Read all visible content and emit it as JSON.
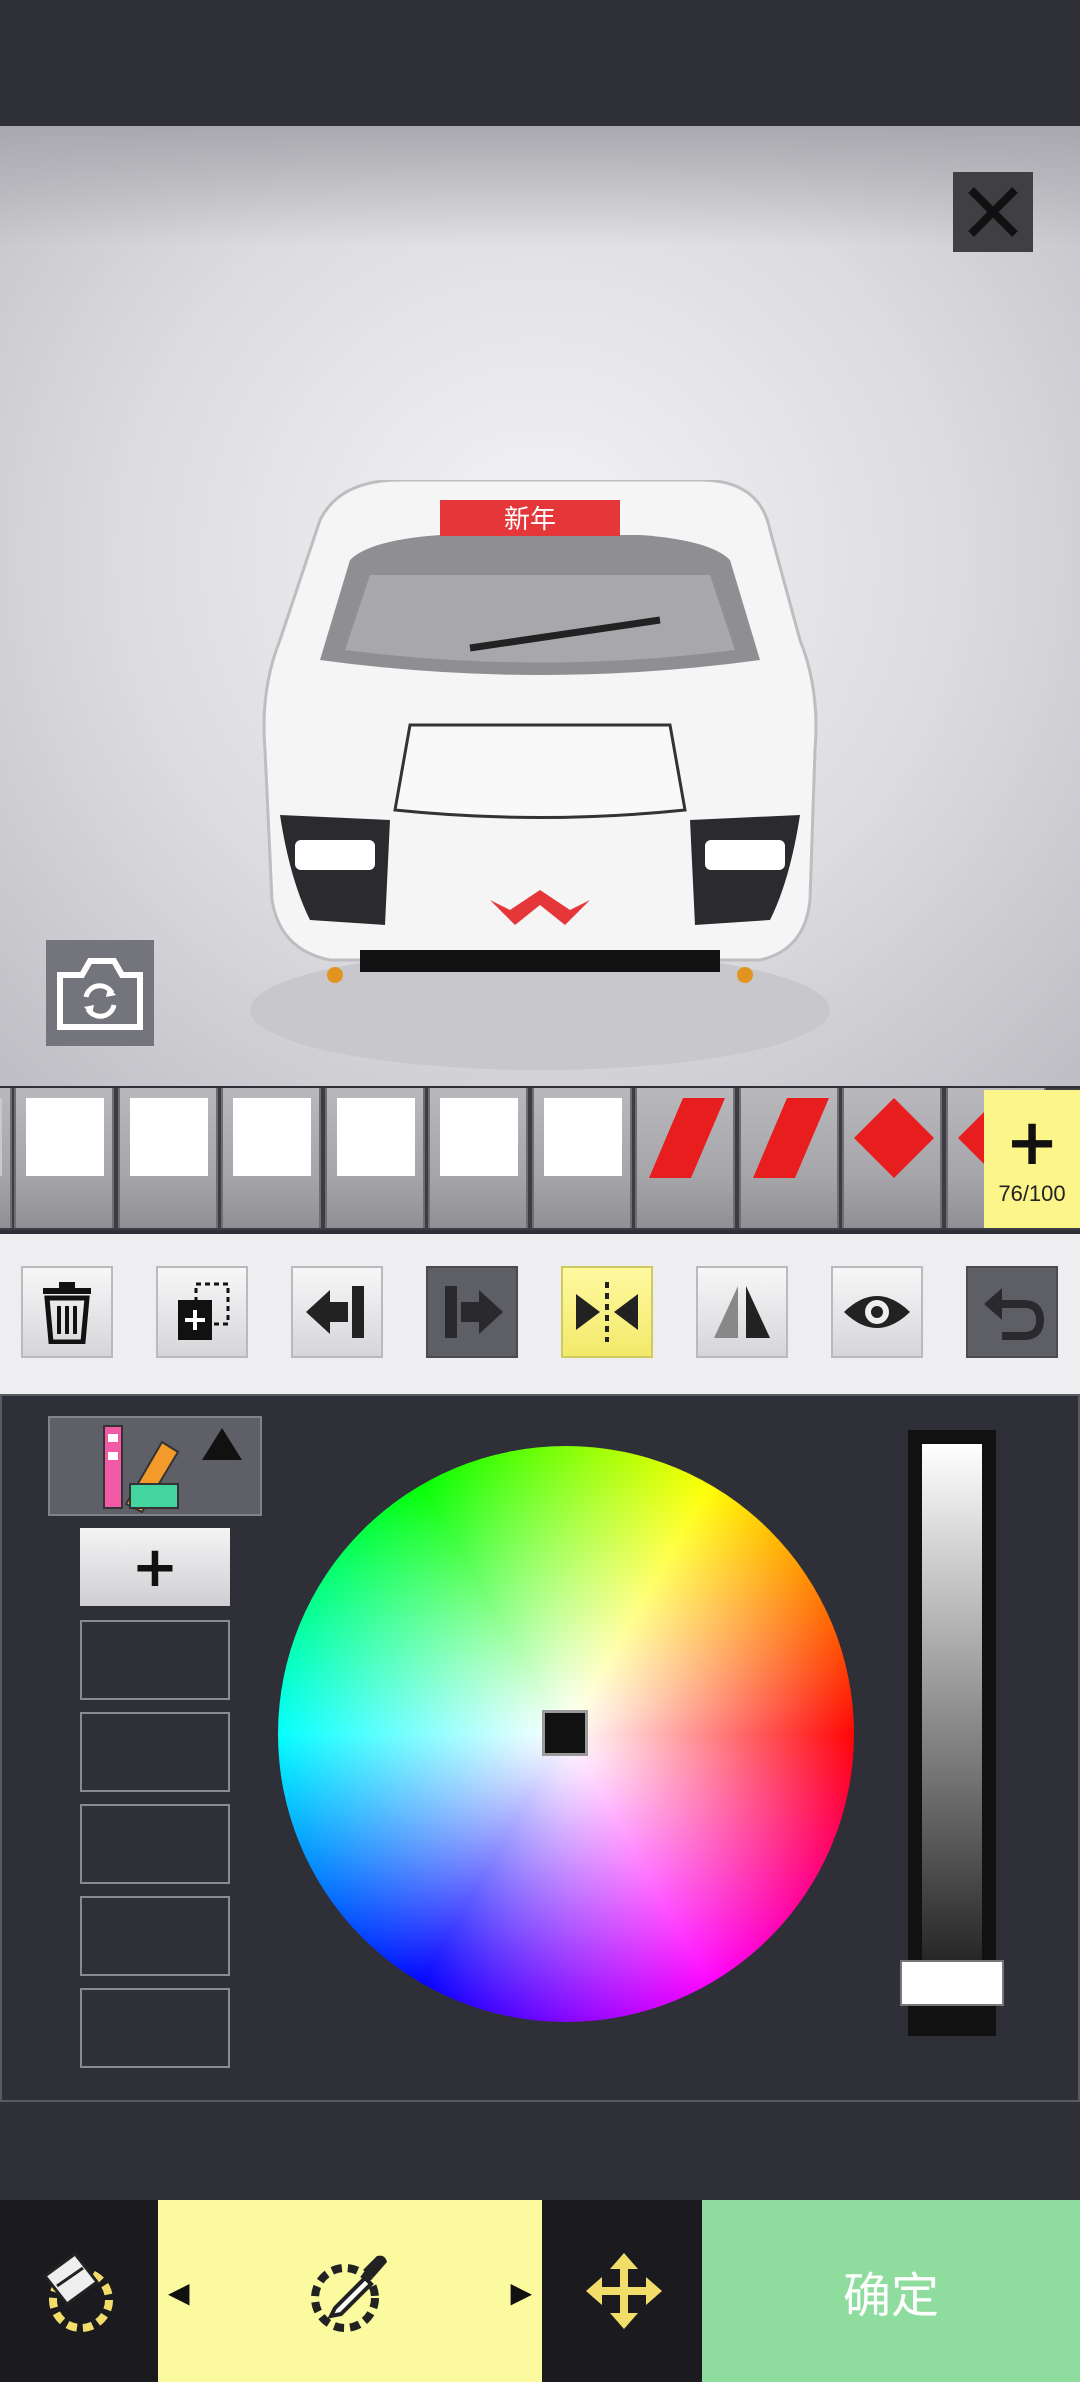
{
  "viewport": {
    "close_icon": "close-icon",
    "camera_icon": "camera-rotate-icon",
    "car_hood_text": "新年",
    "colors": {
      "car_body": "#f5f5f5",
      "decal_red": "#e5363a"
    }
  },
  "sticker_strip": {
    "slots": [
      {
        "type": "white-square"
      },
      {
        "type": "white-square"
      },
      {
        "type": "white-square"
      },
      {
        "type": "white-square"
      },
      {
        "type": "white-square"
      },
      {
        "type": "white-square"
      },
      {
        "type": "red-parallelogram"
      },
      {
        "type": "red-parallelogram"
      },
      {
        "type": "red-diamond"
      },
      {
        "type": "red-diamond"
      }
    ],
    "add_label": "+",
    "count": "76/100"
  },
  "toolbar": {
    "tools": [
      {
        "name": "delete",
        "icon": "trash-icon"
      },
      {
        "name": "duplicate",
        "icon": "duplicate-icon"
      },
      {
        "name": "move-left",
        "icon": "arrow-left-bar-icon"
      },
      {
        "name": "move-right",
        "icon": "arrow-right-bar-icon"
      },
      {
        "name": "mirror-center",
        "icon": "mirror-center-icon"
      },
      {
        "name": "flip",
        "icon": "flip-horizontal-icon"
      },
      {
        "name": "visibility",
        "icon": "eye-icon"
      },
      {
        "name": "undo",
        "icon": "undo-icon"
      }
    ]
  },
  "color_panel": {
    "palette_icon": "color-palette-icon",
    "add_swatch_label": "+",
    "swatch_count": 5,
    "selected_color": "#111111",
    "brightness": 0.0
  },
  "bottom_bar": {
    "sticker_icon": "sticker-icon",
    "paint_icon": "eyedropper-icon",
    "move_icon": "move-icon",
    "confirm_label": "确定",
    "colors": {
      "paint_bg": "#fbfa9e",
      "confirm_bg": "#8fdd9e"
    }
  }
}
